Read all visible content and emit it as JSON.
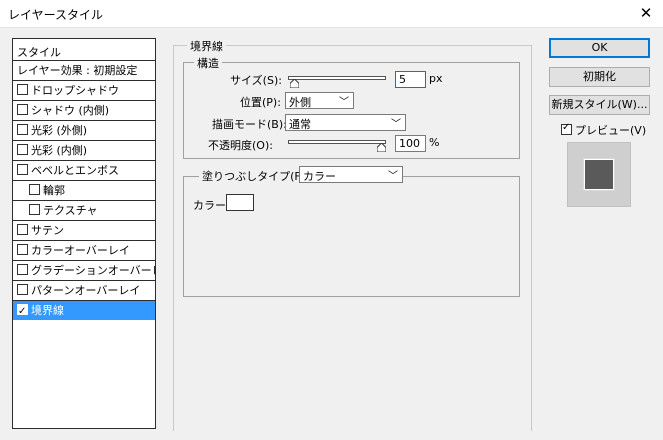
{
  "window": {
    "title": "レイヤースタイル",
    "close_glyph": "✕"
  },
  "styles_panel": {
    "header": "スタイル",
    "items": [
      {
        "label": "レイヤー効果 : 初期設定",
        "checkbox": false,
        "checked": false,
        "indent": 0,
        "selected": false
      },
      {
        "label": "ドロップシャドウ",
        "checkbox": true,
        "checked": false,
        "indent": 0,
        "selected": false
      },
      {
        "label": "シャドウ (内側)",
        "checkbox": true,
        "checked": false,
        "indent": 0,
        "selected": false
      },
      {
        "label": "光彩 (外側)",
        "checkbox": true,
        "checked": false,
        "indent": 0,
        "selected": false
      },
      {
        "label": "光彩 (内側)",
        "checkbox": true,
        "checked": false,
        "indent": 0,
        "selected": false
      },
      {
        "label": "ベベルとエンボス",
        "checkbox": true,
        "checked": false,
        "indent": 0,
        "selected": false
      },
      {
        "label": "輪郭",
        "checkbox": true,
        "checked": false,
        "indent": 1,
        "selected": false
      },
      {
        "label": "テクスチャ",
        "checkbox": true,
        "checked": false,
        "indent": 1,
        "selected": false
      },
      {
        "label": "サテン",
        "checkbox": true,
        "checked": false,
        "indent": 0,
        "selected": false
      },
      {
        "label": "カラーオーバーレイ",
        "checkbox": true,
        "checked": false,
        "indent": 0,
        "selected": false
      },
      {
        "label": "グラデーションオーバーレイ",
        "checkbox": true,
        "checked": false,
        "indent": 0,
        "selected": false
      },
      {
        "label": "パターンオーバーレイ",
        "checkbox": true,
        "checked": false,
        "indent": 0,
        "selected": false
      },
      {
        "label": "境界線",
        "checkbox": true,
        "checked": true,
        "indent": 0,
        "selected": true
      }
    ]
  },
  "stroke": {
    "group_title": "境界線",
    "structure_title": "構造",
    "size_label": "サイズ(S):",
    "size_value": "5",
    "size_unit": "px",
    "size_slider_fraction": 0.02,
    "position_label": "位置(P):",
    "position_value": "外側",
    "blend_label": "描画モード(B):",
    "blend_value": "通常",
    "opacity_label": "不透明度(O):",
    "opacity_value": "100",
    "opacity_unit": "%",
    "opacity_slider_fraction": 1.0,
    "fill_type_label": "塗りつぶしタイプ(F):",
    "fill_type_value": "カラー",
    "color_label": "カラー:",
    "color_swatch": "#ffffff"
  },
  "buttons": {
    "ok": "OK",
    "reset": "初期化",
    "new_style": "新規スタイル(W)...",
    "preview_label": "プレビュー(V)",
    "preview_checked": true
  },
  "preview": {
    "swatch_color": "#5a5a5a",
    "frame_color": "#cfcfcf"
  },
  "colors": {
    "selection": "#3399ff",
    "default_button_border": "#0078d7"
  }
}
